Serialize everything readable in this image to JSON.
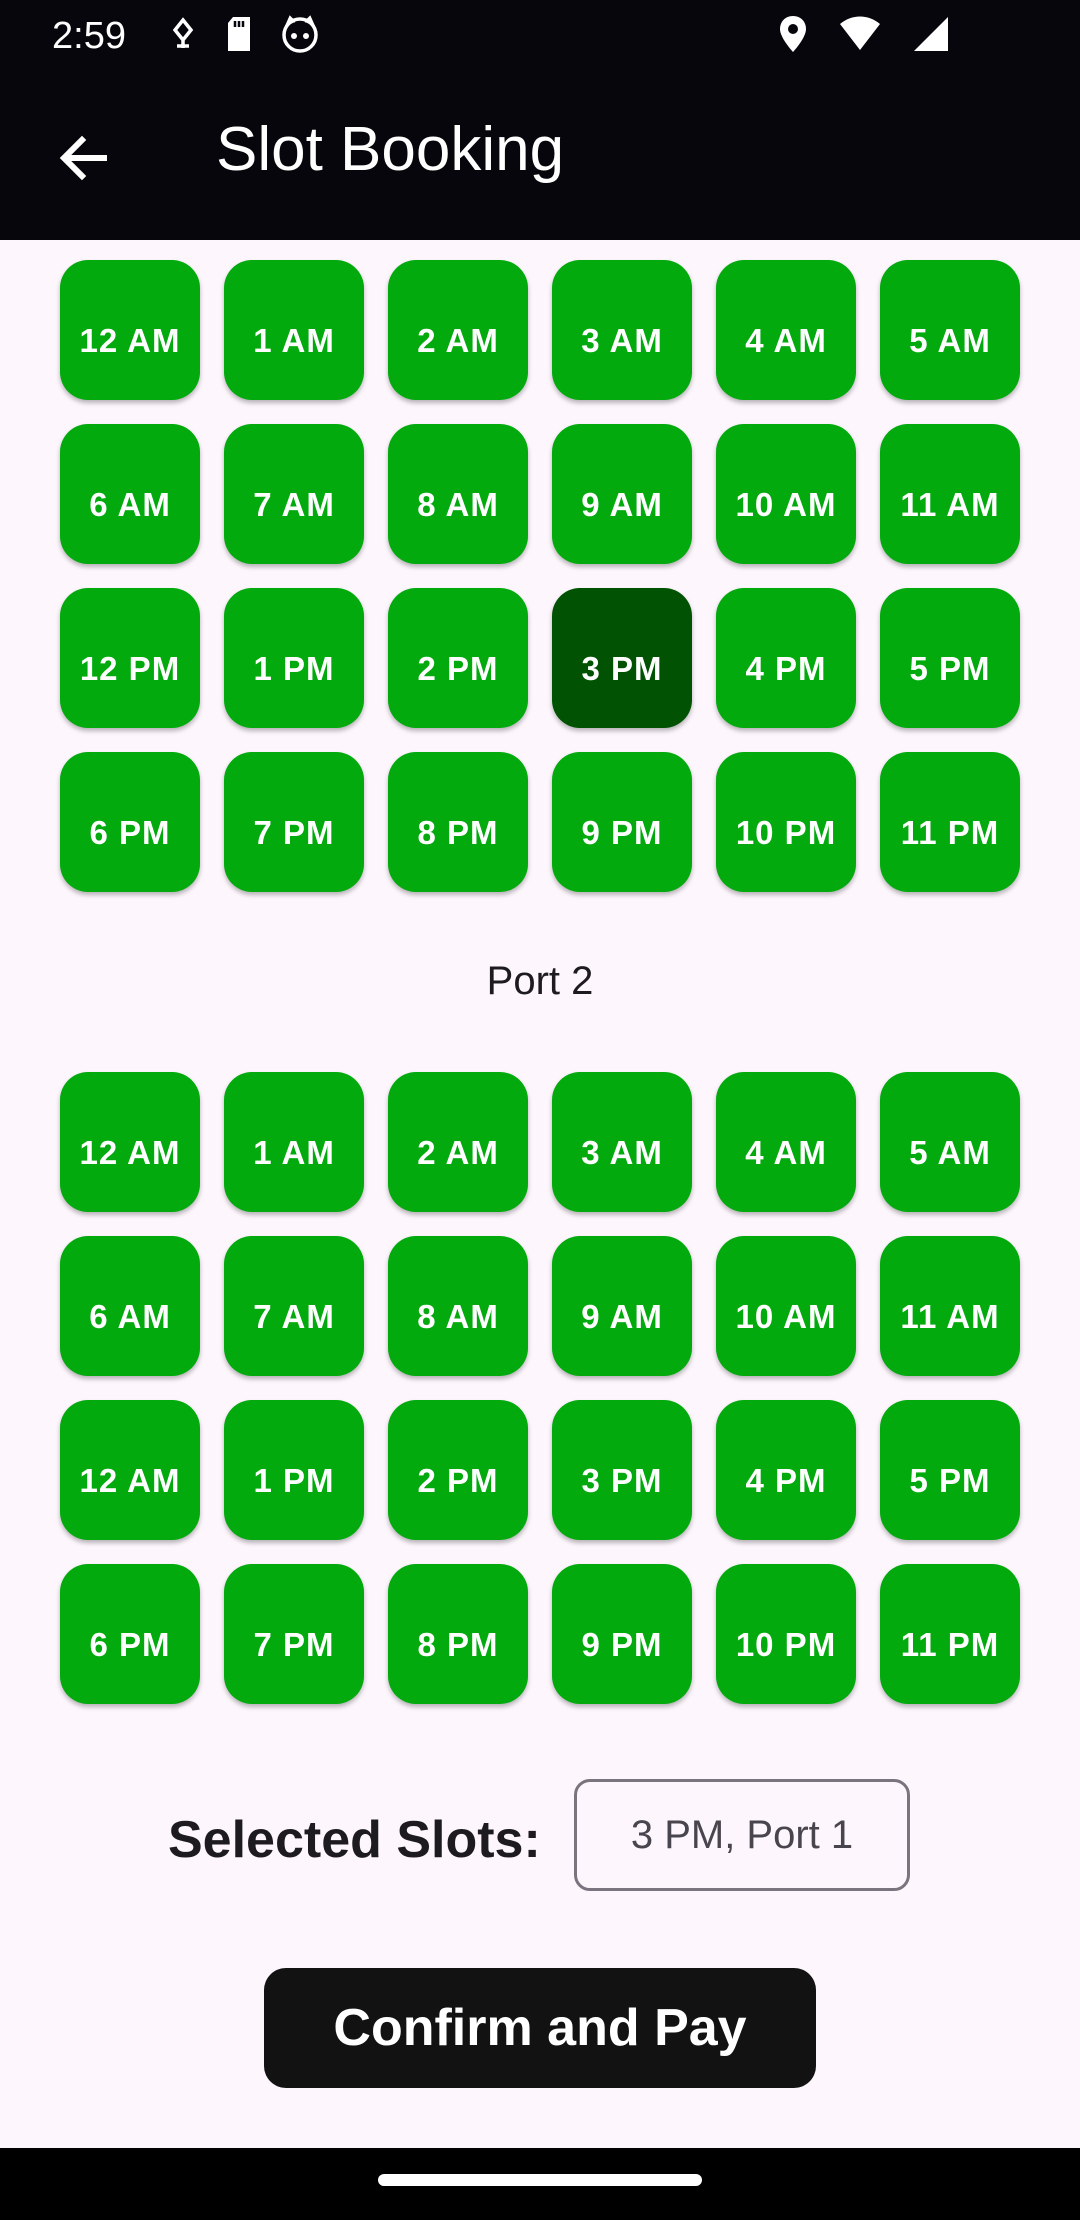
{
  "status_bar": {
    "time": "2:59",
    "left_icons": [
      "fingerprint-icon",
      "sd-card-icon",
      "cat-face-icon"
    ],
    "right_icons": [
      "location-icon",
      "wifi-icon",
      "signal-icon"
    ]
  },
  "app_bar": {
    "back_icon": "arrow-back-icon",
    "title": "Slot Booking"
  },
  "port1": {
    "slots": [
      "12 AM",
      "1 AM",
      "2 AM",
      "3 AM",
      "4 AM",
      "5 AM",
      "6 AM",
      "7 AM",
      "8 AM",
      "9 AM",
      "10 AM",
      "11 AM",
      "12 PM",
      "1 PM",
      "2 PM",
      "3 PM",
      "4 PM",
      "5 PM",
      "6 PM",
      "7 PM",
      "8 PM",
      "9 PM",
      "10 PM",
      "11 PM"
    ],
    "selected_slot": "3 PM"
  },
  "port2": {
    "label": "Port 2",
    "slots": [
      "12 AM",
      "1 AM",
      "2 AM",
      "3 AM",
      "4 AM",
      "5 AM",
      "6 AM",
      "7 AM",
      "8 AM",
      "9 AM",
      "10 AM",
      "11 AM",
      "12 AM",
      "1 PM",
      "2 PM",
      "3 PM",
      "4 PM",
      "5 PM",
      "6 PM",
      "7 PM",
      "8 PM",
      "9 PM",
      "10 PM",
      "11 PM"
    ]
  },
  "selection": {
    "label": "Selected Slots:",
    "value": "3 PM, Port 1"
  },
  "confirm_button": "Confirm and Pay",
  "colors": {
    "slot_available": "#02aa0d",
    "slot_selected": "#015202",
    "app_bar": "#07060c",
    "background": "#fdf7fd"
  }
}
